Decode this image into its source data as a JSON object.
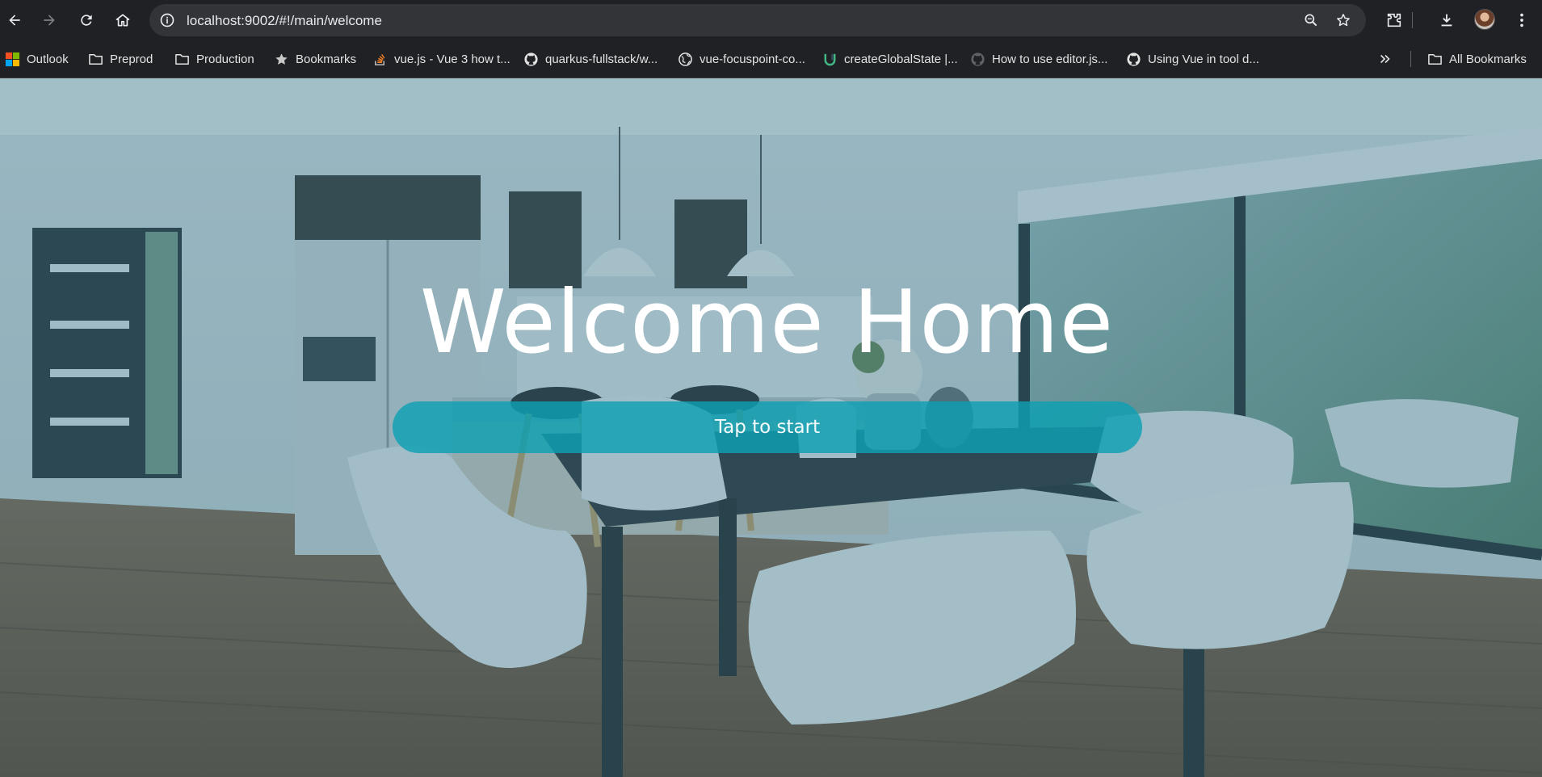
{
  "browser": {
    "url": "localhost:9002/#!/main/welcome",
    "accent": "#0ea0b2"
  },
  "bookmarks": {
    "items": [
      {
        "label": "Outlook",
        "icon": "microsoft-logo-icon"
      },
      {
        "label": "Preprod",
        "icon": "folder-icon"
      },
      {
        "label": "Production",
        "icon": "folder-icon"
      },
      {
        "label": "Bookmarks",
        "icon": "star-icon"
      },
      {
        "label": "vue.js - Vue 3 how t...",
        "icon": "stackoverflow-icon"
      },
      {
        "label": "quarkus-fullstack/w...",
        "icon": "github-icon"
      },
      {
        "label": "vue-focuspoint-co...",
        "icon": "globe-icon"
      },
      {
        "label": "createGlobalState |...",
        "icon": "vueuse-icon"
      },
      {
        "label": "How to use editor.js...",
        "icon": "github-icon"
      },
      {
        "label": "Using Vue in tool d...",
        "icon": "github-icon"
      }
    ],
    "all_bookmarks_label": "All Bookmarks"
  },
  "page": {
    "title": "Welcome Home",
    "cta_label": "Tap to start"
  }
}
